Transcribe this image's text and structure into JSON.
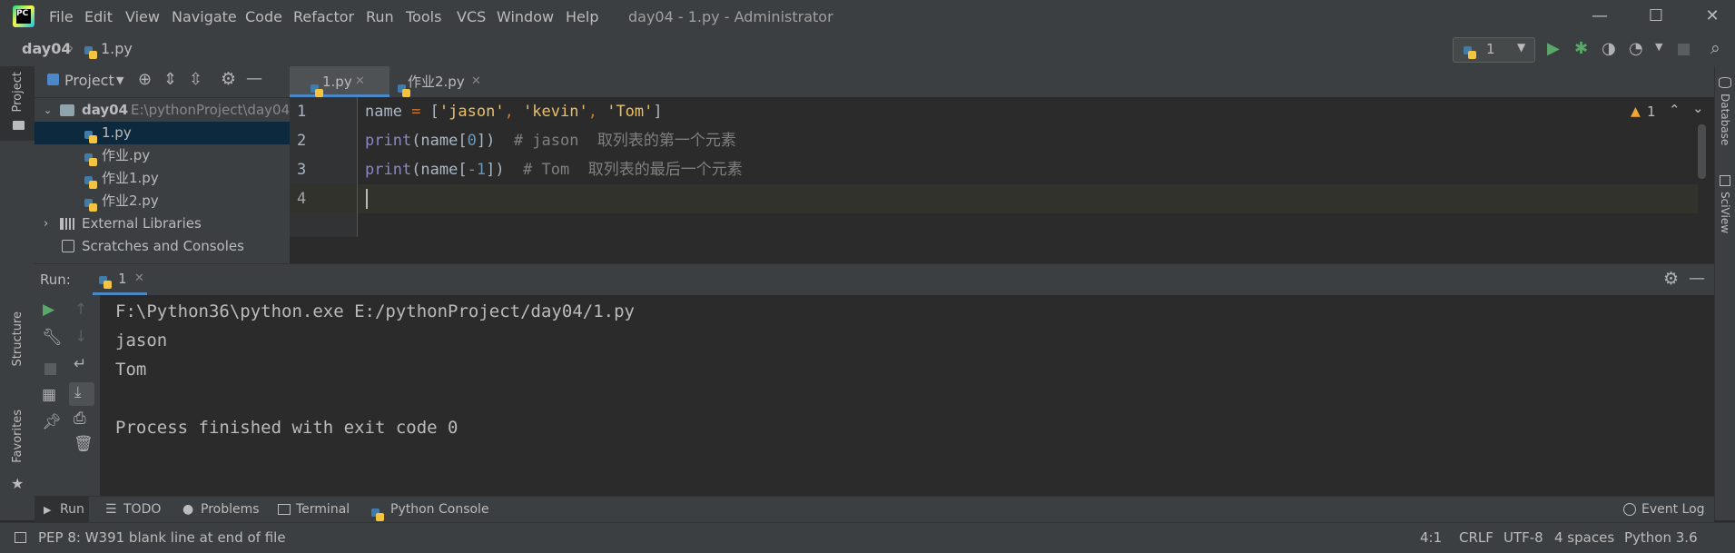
{
  "titlebar": {
    "menus": [
      "File",
      "Edit",
      "View",
      "Navigate",
      "Code",
      "Refactor",
      "Run",
      "Tools",
      "VCS",
      "Window",
      "Help"
    ],
    "window_title": "day04 - 1.py - Administrator",
    "minimize": "—",
    "maximize": "☐",
    "close": "✕"
  },
  "navbar": {
    "breadcrumb_project": "day04",
    "breadcrumb_file": "1.py",
    "run_config": "1"
  },
  "left_strip": {
    "project": "Project",
    "structure": "Structure",
    "favorites": "Favorites"
  },
  "right_strip": {
    "database": "Database",
    "sciview": "SciView"
  },
  "project_panel": {
    "title": "Project",
    "root_name": "day04",
    "root_path": "E:\\pythonProject\\day04",
    "files": [
      "1.py",
      "作业.py",
      "作业1.py",
      "作业2.py"
    ],
    "external": "External Libraries",
    "scratches": "Scratches and Consoles"
  },
  "editor": {
    "tabs": [
      "1.py",
      "作业2.py"
    ],
    "line_numbers": [
      "1",
      "2",
      "3",
      "4"
    ],
    "warnings": "1",
    "code": {
      "l1": {
        "a": "name ",
        "b": "= ",
        "c": "[",
        "d": "'jason'",
        ", ": ", ",
        "e": "'kevin'",
        "f": "'Tom'",
        "g": "]"
      },
      "l2": {
        "fn": "print",
        "a": "(name[",
        "n": "0",
        "b": "])",
        "cm": "  # jason  取列表的第一个元素"
      },
      "l3": {
        "fn": "print",
        "a": "(name[",
        "n": "-1",
        "b": "])",
        "cm": "  # Tom  取列表的最后一个元素"
      }
    }
  },
  "run_panel": {
    "label": "Run:",
    "tab": "1",
    "output": [
      "F:\\Python36\\python.exe E:/pythonProject/day04/1.py",
      "jason",
      "Tom",
      "",
      "Process finished with exit code 0"
    ]
  },
  "bottom_tabs": [
    "Run",
    "TODO",
    "Problems",
    "Terminal",
    "Python Console"
  ],
  "event_log": "Event Log",
  "status": {
    "message": "PEP 8: W391 blank line at end of file",
    "position": "4:1",
    "line_sep": "CRLF",
    "encoding": "UTF-8",
    "indent": "4 spaces",
    "interpreter": "Python 3.6"
  }
}
